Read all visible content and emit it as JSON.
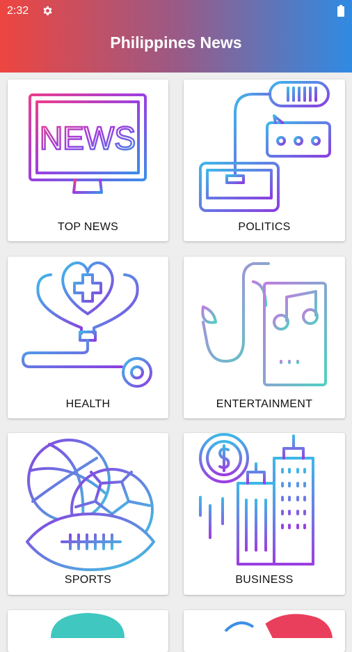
{
  "status_bar": {
    "time": "2:32",
    "settings_icon": "gear-icon",
    "battery_icon": "battery-icon"
  },
  "app_bar": {
    "title": "Philippines News"
  },
  "categories": [
    {
      "label": "TOP NEWS",
      "icon": "news-monitor-icon",
      "screen_text": "NEWS"
    },
    {
      "label": "POLITICS",
      "icon": "microphone-speech-icon"
    },
    {
      "label": "HEALTH",
      "icon": "health-stethoscope-icon"
    },
    {
      "label": "ENTERTAINMENT",
      "icon": "music-saxophone-icon"
    },
    {
      "label": "SPORTS",
      "icon": "sports-balls-icon"
    },
    {
      "label": "BUSINESS",
      "icon": "business-city-icon"
    },
    {
      "icon": "category-icon"
    },
    {
      "icon": "category-icon"
    }
  ]
}
